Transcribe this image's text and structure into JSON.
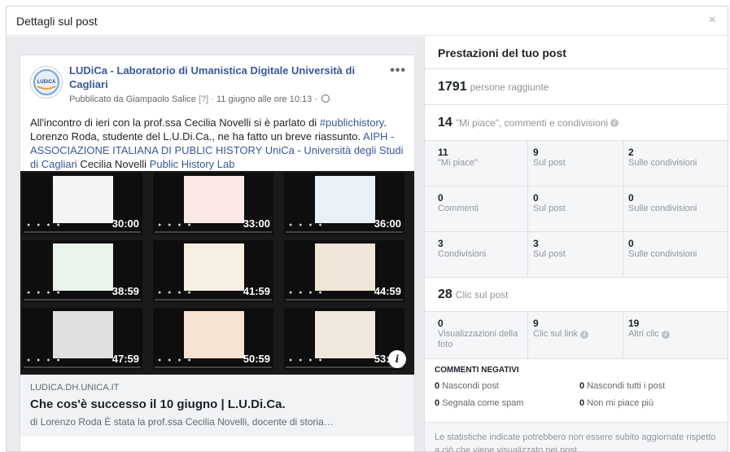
{
  "modal": {
    "title": "Dettagli sul post",
    "close": "×"
  },
  "post": {
    "avatar_text": "LUDiCA",
    "page_name": "LUDiCa - Laboratorio di Umanistica Digitale Università di Cagliari",
    "meta_prefix": "Pubblicato da Giampaolo Salice",
    "meta_q": "[?]",
    "meta_date": " · 11 giugno alle ore 10:13 ·",
    "more": "•••",
    "text_1": "All'incontro di ieri con la prof.ssa Cecilia Novelli si è parlato di ",
    "link_1": "#publichistory",
    "text_2": ". Lorenzo Roda, studente del L.U.Di.Ca., ne ha fatto un breve riassunto. ",
    "link_2": "AIPH - ASSOCIAZIONE ITALIANA DI PUBLIC HISTORY UniCa - Università degli Studi di Cagliari",
    "text_3": " Cecilia Novelli ",
    "link_3": "Public History Lab",
    "video_times": [
      "30:00",
      "33:00",
      "36:00",
      "38:59",
      "41:59",
      "44:59",
      "47:59",
      "50:59",
      "53:59"
    ],
    "info_btn": "i",
    "link_domain": "LUDICA.DH.UNICA.IT",
    "link_title": "Che cos'è successo il 10 giugno | L.U.Di.Ca.",
    "link_desc": "di Lorenzo Roda È stata la prof.ssa Cecilia Novelli, docente di storia…"
  },
  "performance": {
    "title": "Prestazioni del tuo post",
    "reach_num": "1791",
    "reach_label": "persone raggiunte",
    "engage_num": "14",
    "engage_label": "\"Mi piace\", commenti e condivisioni",
    "likes": [
      {
        "num": "11",
        "label": "\"Mi piace\""
      },
      {
        "num": "9",
        "label": "Sul post"
      },
      {
        "num": "2",
        "label": "Sulle condivisioni"
      }
    ],
    "comments": [
      {
        "num": "0",
        "label": "Commenti"
      },
      {
        "num": "0",
        "label": "Sul post"
      },
      {
        "num": "0",
        "label": "Sulle condivisioni"
      }
    ],
    "shares": [
      {
        "num": "3",
        "label": "Condivisioni"
      },
      {
        "num": "3",
        "label": "Sul post"
      },
      {
        "num": "0",
        "label": "Sulle condivisioni"
      }
    ],
    "clicks_num": "28",
    "clicks_label": "Clic sul post",
    "clicks": [
      {
        "num": "0",
        "label": "Visualizzazioni della foto"
      },
      {
        "num": "9",
        "label": "Clic sul link"
      },
      {
        "num": "19",
        "label": "Altri clic"
      }
    ],
    "negative_title": "COMMENTI NEGATIVI",
    "negative": [
      {
        "num": "0",
        "label": "Nascondi post"
      },
      {
        "num": "0",
        "label": "Nascondi tutti i post"
      },
      {
        "num": "0",
        "label": "Segnala come spam"
      },
      {
        "num": "0",
        "label": "Non mi piace più"
      }
    ],
    "note": "Le statistiche indicate potrebbero non essere subito aggiornate rispetto a ciò che viene visualizzato nei post"
  }
}
